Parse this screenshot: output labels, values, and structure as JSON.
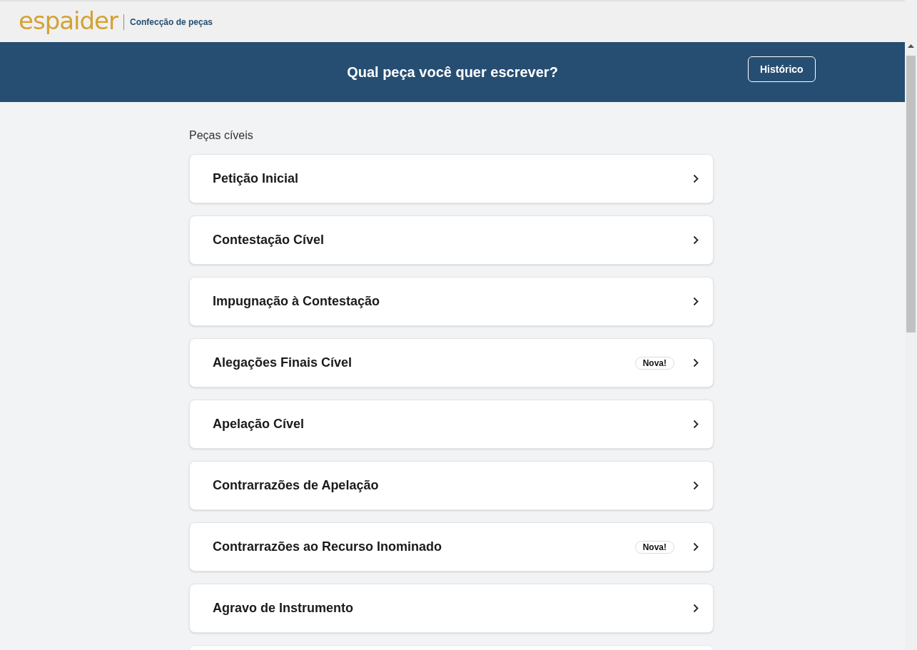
{
  "header": {
    "logo": "espaider",
    "subtitle": "Confecção de peças"
  },
  "banner": {
    "title": "Qual peça você quer escrever?",
    "button": "Histórico"
  },
  "section": {
    "title": "Peças cíveis",
    "items": [
      {
        "label": "Petição Inicial"
      },
      {
        "label": "Contestação Cível"
      },
      {
        "label": "Impugnação à Contestação"
      },
      {
        "label": "Alegações Finais Cível",
        "badge": "Nova!"
      },
      {
        "label": "Apelação Cível"
      },
      {
        "label": "Contrarrazões de Apelação"
      },
      {
        "label": "Contrarrazões ao Recurso Inominado",
        "badge": "Nova!"
      },
      {
        "label": "Agravo de Instrumento"
      }
    ]
  }
}
